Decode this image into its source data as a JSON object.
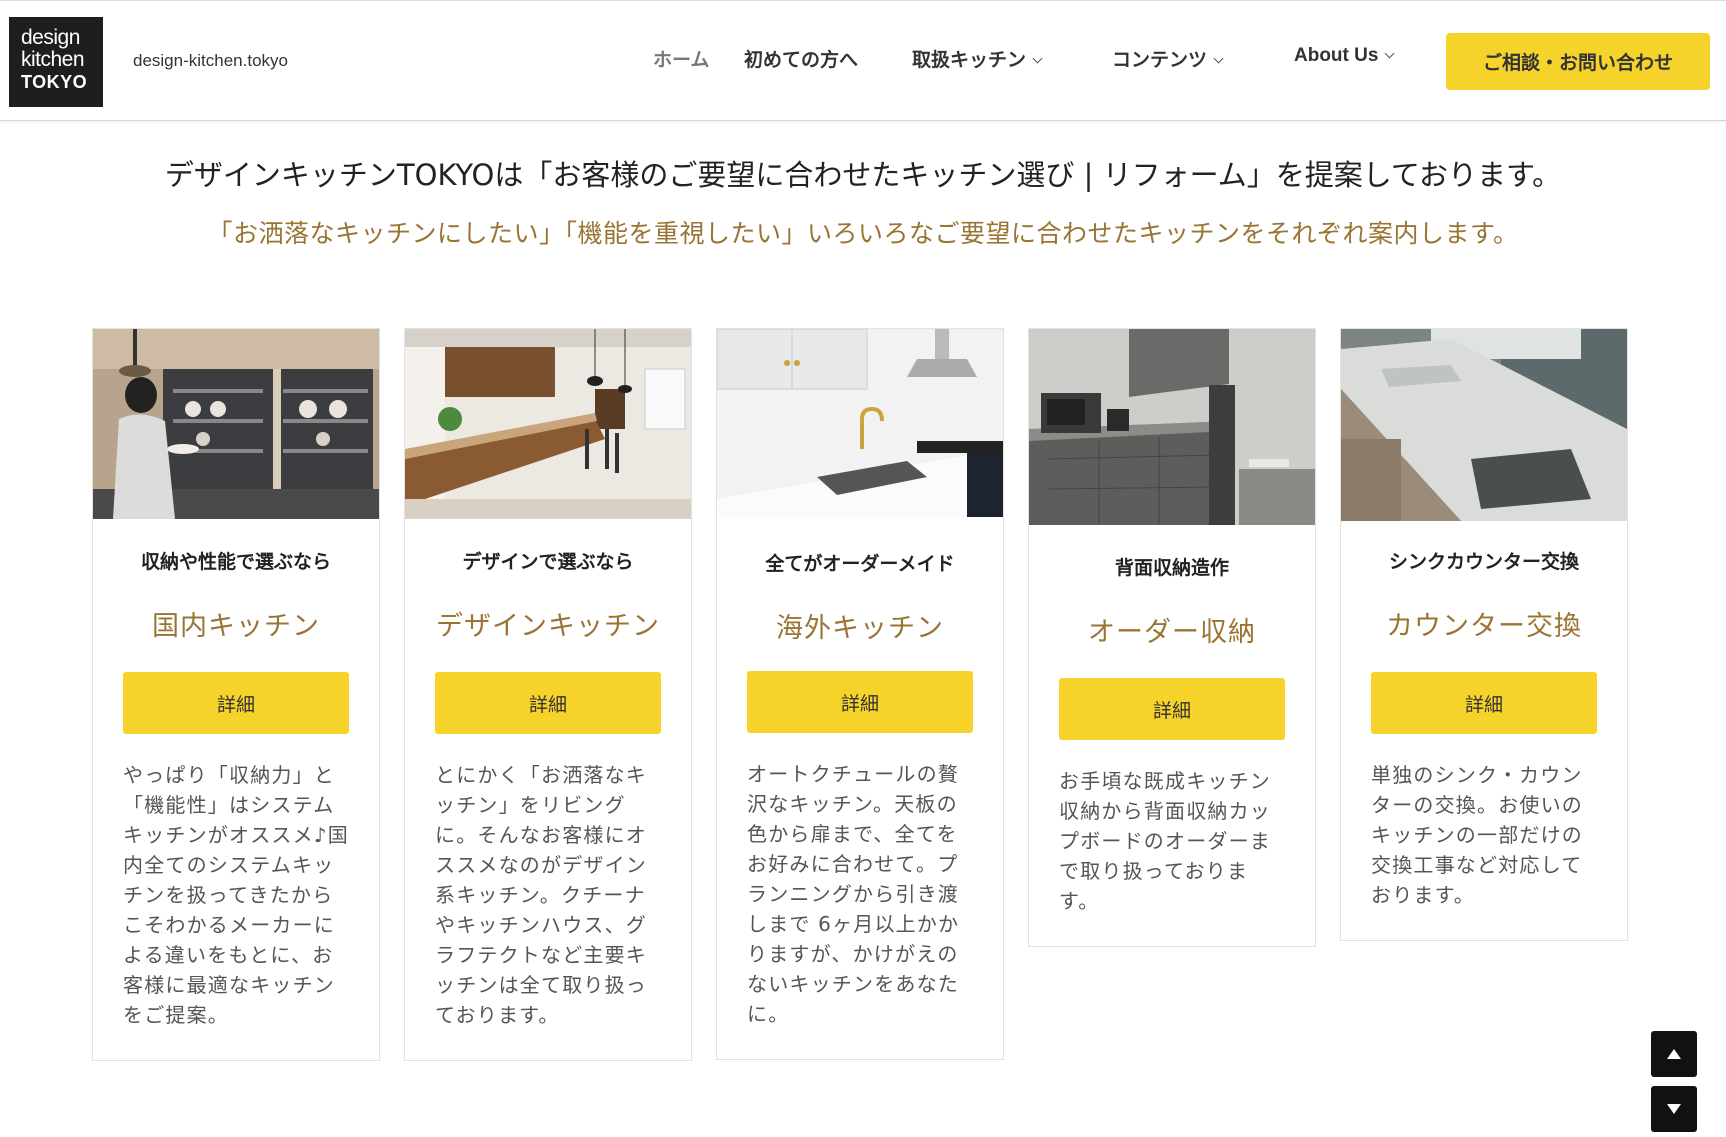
{
  "header": {
    "logo": {
      "line1": "design",
      "line2": "kitchen",
      "line3": "TOKYO"
    },
    "site_url": "design-kitchen.tokyo",
    "nav": [
      {
        "label": "ホーム"
      },
      {
        "label": "初めての方へ"
      },
      {
        "label": "取扱キッチン",
        "dropdown": true
      },
      {
        "label": "コンテンツ",
        "dropdown": true
      },
      {
        "label": "About Us",
        "dropdown": true
      }
    ],
    "cta_label": "ご相談・お問い合わせ"
  },
  "intro": {
    "headline": "デザインキッチンTOKYOは「お客様のご要望に合わせたキッチン選び | リフォーム」を提案しております。",
    "subline": "「お洒落なキッチンにしたい」「機能を重視したい」いろいろなご要望に合わせたキッチンをそれぞれ案内します。"
  },
  "cards": [
    {
      "subtitle": "収納や性能で選ぶなら",
      "title": "国内キッチン",
      "button": "詳細",
      "description": "やっぱり「収納力」と「機能性」はシステムキッチンがオススメ♪国内全てのシステムキッチンを扱ってきたからこそわかるメーカーによる違いをもとに、お客様に最適なキッチンをご提案。"
    },
    {
      "subtitle": "デザインで選ぶなら",
      "title": "デザインキッチン",
      "button": "詳細",
      "description": "とにかく「お洒落なキッチン」をリビングに。そんなお客様にオススメなのがデザイン系キッチン。クチーナやキッチンハウス、グラフテクトなど主要キッチンは全て取り扱っております。"
    },
    {
      "subtitle": "全てがオーダーメイド",
      "title": "海外キッチン",
      "button": "詳細",
      "description": "オートクチュールの贅沢なキッチン。天板の色から扉まで、全てをお好みに合わせて。プランニングから引き渡しまで 6ヶ月以上かかりますが、かけがえのないキッチンをあなたに。"
    },
    {
      "subtitle": "背面収納造作",
      "title": "オーダー収納",
      "button": "詳細",
      "description": "お手頃な既成キッチン収納から背面収納カップボードのオーダーまで取り扱っております。"
    },
    {
      "subtitle": "シンクカウンター交換",
      "title": "カウンター交換",
      "button": "詳細",
      "description": "単独のシンク・カウンターの交換。お使いのキッチンの一部だけの交換工事など対応しております。"
    }
  ],
  "colors": {
    "accent": "#f6d32a",
    "title_gold": "#9a7433",
    "logo_bg": "#1e1e1e"
  },
  "icons": {
    "scroll_up": "triangle-up-icon",
    "scroll_down": "triangle-down-icon"
  }
}
